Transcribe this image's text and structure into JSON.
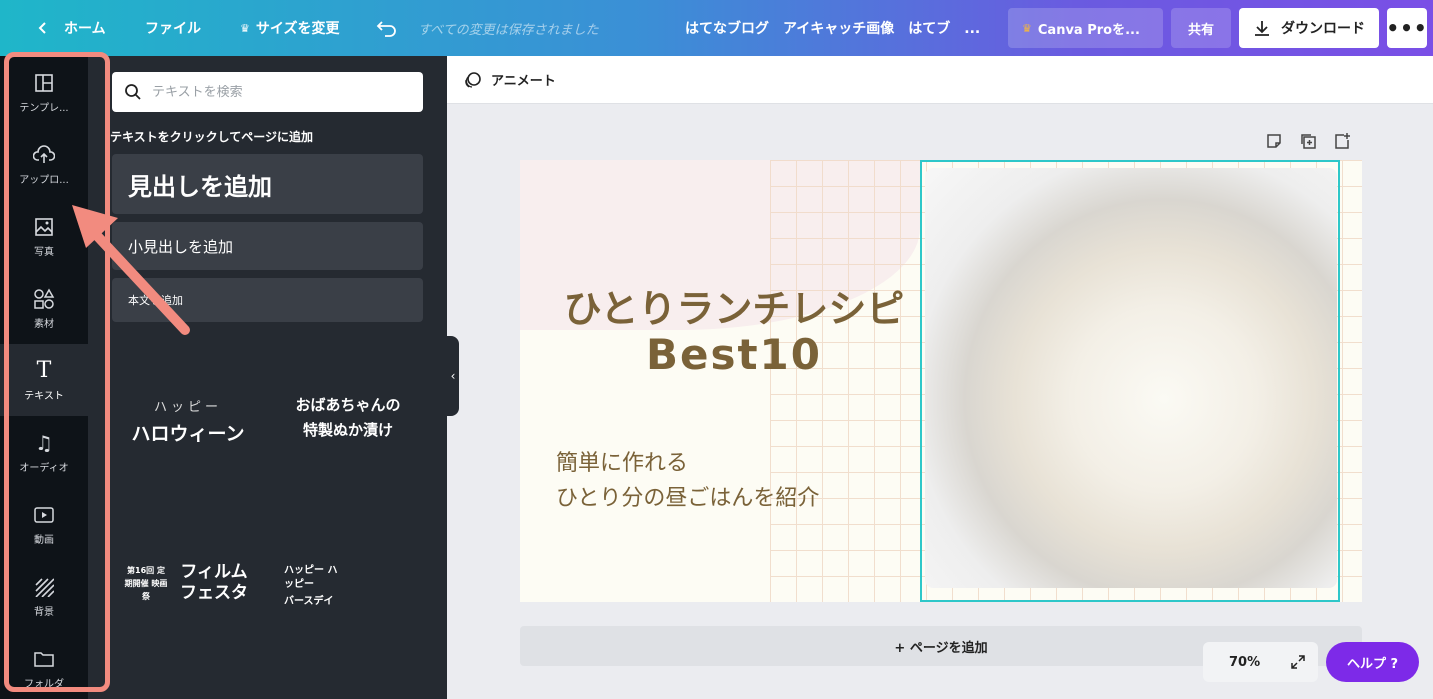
{
  "topbar": {
    "home": "ホーム",
    "file": "ファイル",
    "resize": "サイズを変更",
    "saved_status": "すべての変更は保存されました",
    "doc_title": "はてなブログ　アイキャッチ画像　はてブ　...",
    "pro": "Canva Proを...",
    "share": "共有",
    "download": "ダウンロード",
    "more": "•••"
  },
  "rail": {
    "items": [
      {
        "label": "テンプレ...",
        "icon": "template-icon"
      },
      {
        "label": "アップロ...",
        "icon": "upload-cloud-icon"
      },
      {
        "label": "写真",
        "icon": "photo-icon"
      },
      {
        "label": "素材",
        "icon": "elements-icon"
      },
      {
        "label": "テキスト",
        "icon": "text-icon"
      },
      {
        "label": "オーディオ",
        "icon": "music-icon"
      },
      {
        "label": "動画",
        "icon": "video-icon"
      },
      {
        "label": "背景",
        "icon": "background-icon"
      },
      {
        "label": "フォルダ",
        "icon": "folder-icon"
      }
    ],
    "active": "テキスト"
  },
  "panel": {
    "search_placeholder": "テキストを検索",
    "hint": "テキストをクリックしてページに追加",
    "heading": "見出しを追加",
    "subheading": "小見出しを追加",
    "body": "本文を追加",
    "templates": [
      {
        "line1": "ハッピー",
        "line2": "ハロウィーン"
      },
      {
        "line1": "おばあちゃんの",
        "line2": "特製ぬか漬け"
      },
      {
        "line1": "第16回 定期開催 映画祭",
        "line2": "フィルム フェスタ"
      },
      {
        "line1": "ハッピー ハッピー",
        "line2": "バースデイ"
      }
    ]
  },
  "editor": {
    "animate": "アニメート",
    "design": {
      "title_line1": "ひとりランチレシピ",
      "title_line2": "Best10",
      "subtitle_line1": "簡単に作れる",
      "subtitle_line2": "ひとり分の昼ごはんを紹介"
    },
    "add_page": "+ ページを追加",
    "zoom": "70%",
    "help": "ヘルプ ?"
  },
  "colors": {
    "accent_teal": "#2ec7c9",
    "annotation": "#f28b7f",
    "help_purple": "#7d2ae8",
    "title_brown": "#7a6238"
  }
}
